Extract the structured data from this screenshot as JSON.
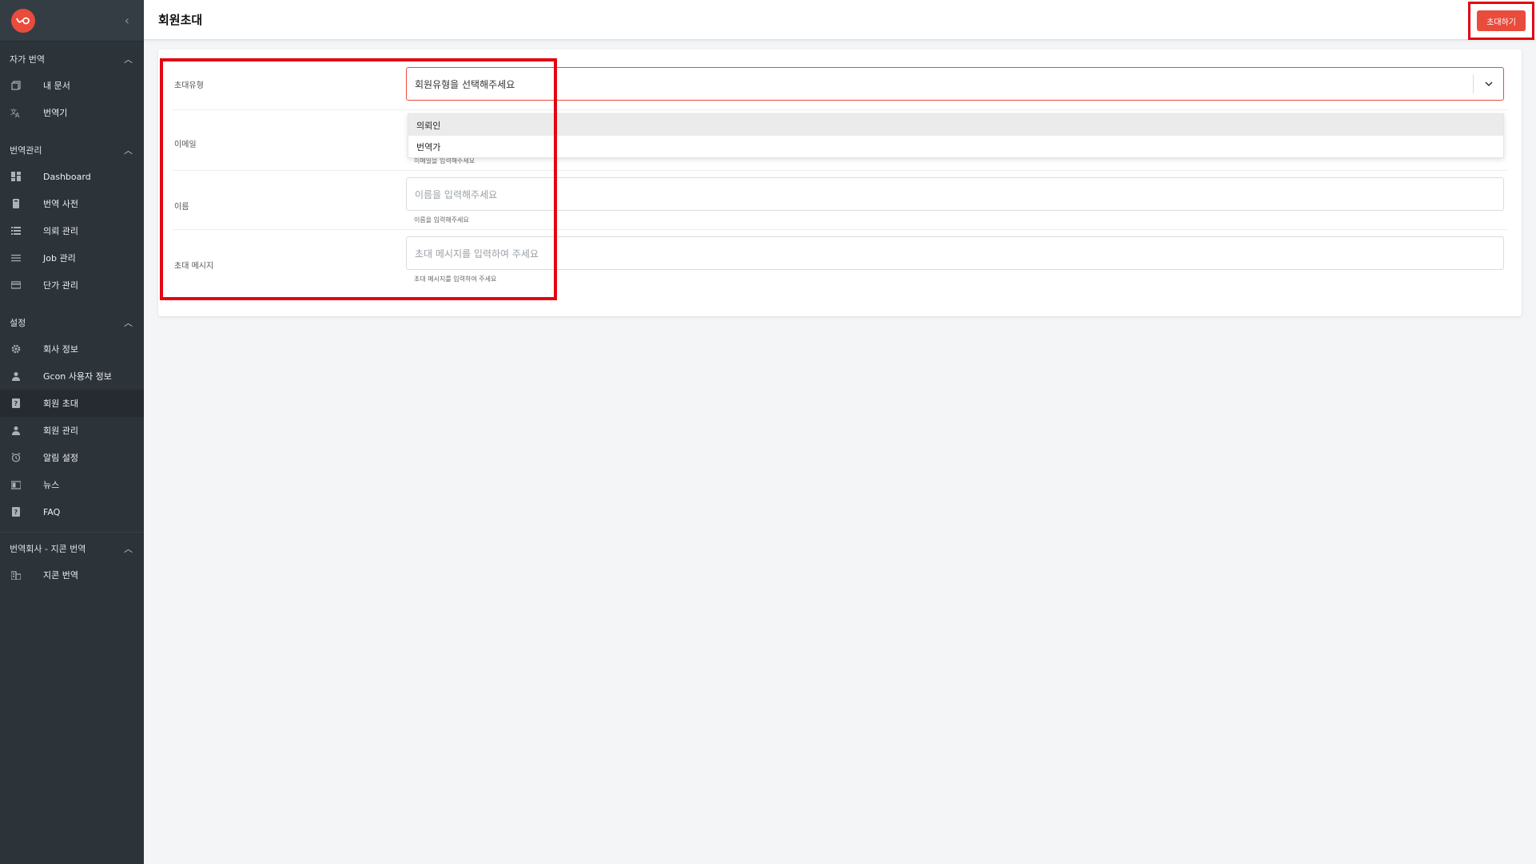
{
  "sidebar": {
    "sections": [
      {
        "title": "자가 번역",
        "items": [
          {
            "label": "내 문서",
            "icon": "documents-icon"
          },
          {
            "label": "번역기",
            "icon": "translate-icon"
          }
        ]
      },
      {
        "title": "번역관리",
        "items": [
          {
            "label": "Dashboard",
            "icon": "dashboard-icon"
          },
          {
            "label": "번역 사전",
            "icon": "book-icon"
          },
          {
            "label": "의뢰 관리",
            "icon": "list-icon"
          },
          {
            "label": "Job 관리",
            "icon": "list-lines-icon"
          },
          {
            "label": "단가 관리",
            "icon": "card-icon"
          }
        ]
      },
      {
        "title": "설정",
        "items": [
          {
            "label": "회사 정보",
            "icon": "gear-icon"
          },
          {
            "label": "Gcon 사용자 정보",
            "icon": "person-icon"
          },
          {
            "label": "회원 초대",
            "icon": "help-icon"
          },
          {
            "label": "회원 관리",
            "icon": "person-icon"
          },
          {
            "label": "알림 설정",
            "icon": "alarm-icon"
          },
          {
            "label": "뉴스",
            "icon": "news-icon"
          },
          {
            "label": "FAQ",
            "icon": "help-icon"
          }
        ]
      },
      {
        "title": "번역회사 - 지콘 번역",
        "items": [
          {
            "label": "지콘 번역",
            "icon": "building-icon"
          }
        ]
      }
    ]
  },
  "header": {
    "title": "회원초대",
    "invite_button": "초대하기"
  },
  "form": {
    "type_label": "초대유형",
    "type_placeholder": "회원유형을 선택해주세요",
    "type_options": [
      "의뢰인",
      "번역가"
    ],
    "email_label": "이메일",
    "email_helper": "이메일을 입력해주세요",
    "name_label": "이름",
    "name_placeholder": "이름을 입력해주세요",
    "name_helper": "이름을 입력해주세요",
    "message_label": "초대 메시지",
    "message_placeholder": "초대 메시지를 입력하여 주세요",
    "message_helper": "초대 메시지를 입력하여 주세요"
  },
  "colors": {
    "accent": "#e94b3c",
    "sidebar_bg": "#2c3339",
    "highlight": "#e30613"
  }
}
